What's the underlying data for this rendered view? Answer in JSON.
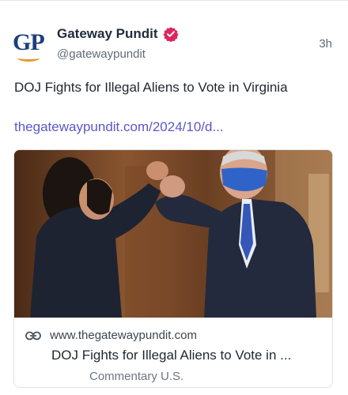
{
  "post": {
    "author": {
      "name": "Gateway Pundit",
      "handle": "@gatewaypundit",
      "avatar_text": "GP",
      "verified": true,
      "verified_color": "#e0245e"
    },
    "time": "3h",
    "text": "DOJ Fights for Illegal Aliens to Vote in Virginia",
    "link": "thegatewaypundit.com/2024/10/d...",
    "link_color": "#5b57c8"
  },
  "card": {
    "image_icon": "photo-two-people-elbow-bump",
    "domain_icon": "link-icon",
    "domain": "www.thegatewaypundit.com",
    "title": "DOJ Fights for Illegal Aliens to Vote in ...",
    "category": "Commentary U.S."
  }
}
